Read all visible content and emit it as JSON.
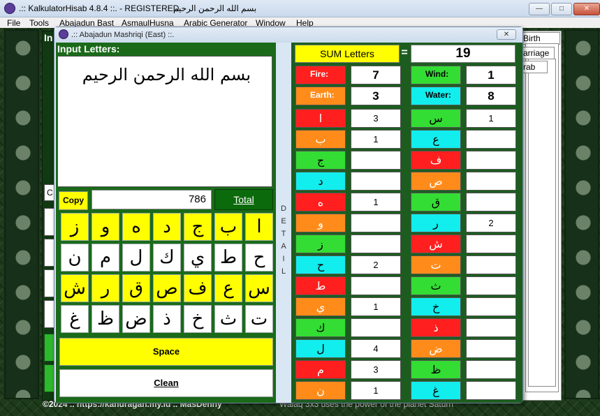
{
  "app": {
    "title": ".:: KalkulatorHisab 4.8.4 ::. - REGISTERED",
    "title_arabic": "بسم الله الرحمن الرحيم",
    "window_buttons": [
      "—",
      "□",
      "✕"
    ]
  },
  "menu": {
    "items": [
      "File",
      "Tools",
      "Abajadun Bast",
      "AsmaulHusna",
      "Arabic Generator",
      "Window",
      "Help"
    ]
  },
  "background": {
    "tabs": [
      "Birth",
      "arriage",
      "rab"
    ],
    "left_label": "In",
    "left_buttons": [
      "C"
    ],
    "status_left": "©2024 ..  https://kahuragan.my.id  ..  MasDenny",
    "status_right": "Walaq 3x3 uses the power of the planet Saturn"
  },
  "dialog": {
    "title": ".:: Abajadun Mashriqi (East) ::.",
    "close": "✕",
    "input_label": "Input Letters:",
    "input_text": "بسم الله الرحمن الرحيم",
    "copy": "Copy",
    "total_value": "786",
    "total_btn": "Total",
    "space": "Space",
    "clean": "Clean",
    "detail": [
      "D",
      "E",
      "T",
      "A",
      "I",
      "L"
    ],
    "keyboard": [
      [
        "ا",
        "ب",
        "ج",
        "د",
        "ه",
        "و",
        "ز"
      ],
      [
        "ح",
        "ط",
        "ي",
        "ك",
        "ل",
        "م",
        "ن"
      ],
      [
        "س",
        "ع",
        "ف",
        "ص",
        "ق",
        "ر",
        "ش"
      ],
      [
        "ت",
        "ث",
        "خ",
        "ذ",
        "ض",
        "ظ",
        "غ"
      ]
    ]
  },
  "summary": {
    "sum_label": "SUM Letters",
    "equals": "=",
    "sum_value": "19",
    "fire_label": "Fire:",
    "fire_value": "7",
    "wind_label": "Wind:",
    "wind_value": "1",
    "earth_label": "Earth:",
    "earth_value": "3",
    "water_label": "Water:",
    "water_value": "8"
  },
  "colors": {
    "fire": "#ff1f1f",
    "earth": "#ff8c1a",
    "wind": "#33dd33",
    "water": "#12eded"
  },
  "letters_left": [
    {
      "l": "ا",
      "c": "red",
      "v": "3"
    },
    {
      "l": "ب",
      "c": "orange",
      "v": "1"
    },
    {
      "l": "ج",
      "c": "green",
      "v": ""
    },
    {
      "l": "د",
      "c": "cyan",
      "v": ""
    },
    {
      "l": "ه",
      "c": "red",
      "v": "1"
    },
    {
      "l": "و",
      "c": "orange",
      "v": ""
    },
    {
      "l": "ز",
      "c": "green",
      "v": ""
    },
    {
      "l": "ح",
      "c": "cyan",
      "v": "2"
    },
    {
      "l": "ط",
      "c": "red",
      "v": ""
    },
    {
      "l": "ي",
      "c": "orange",
      "v": "1"
    },
    {
      "l": "ك",
      "c": "green",
      "v": ""
    },
    {
      "l": "ل",
      "c": "cyan",
      "v": "4"
    },
    {
      "l": "م",
      "c": "red",
      "v": "3"
    },
    {
      "l": "ن",
      "c": "orange",
      "v": "1"
    }
  ],
  "letters_right": [
    {
      "l": "س",
      "c": "green",
      "v": "1"
    },
    {
      "l": "ع",
      "c": "cyan",
      "v": ""
    },
    {
      "l": "ف",
      "c": "red",
      "v": ""
    },
    {
      "l": "ص",
      "c": "orange",
      "v": ""
    },
    {
      "l": "ق",
      "c": "green",
      "v": ""
    },
    {
      "l": "ر",
      "c": "cyan",
      "v": "2"
    },
    {
      "l": "ش",
      "c": "red",
      "v": ""
    },
    {
      "l": "ت",
      "c": "orange",
      "v": ""
    },
    {
      "l": "ث",
      "c": "green",
      "v": ""
    },
    {
      "l": "خ",
      "c": "cyan",
      "v": ""
    },
    {
      "l": "ذ",
      "c": "red",
      "v": ""
    },
    {
      "l": "ض",
      "c": "orange",
      "v": ""
    },
    {
      "l": "ظ",
      "c": "green",
      "v": ""
    },
    {
      "l": "غ",
      "c": "cyan",
      "v": ""
    }
  ]
}
